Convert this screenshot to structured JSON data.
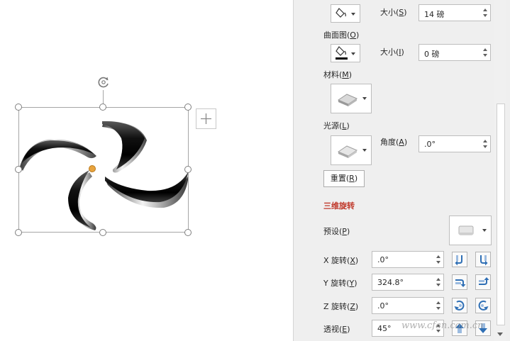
{
  "panel": {
    "size_top": {
      "label": "大小",
      "accel": "S",
      "value": "14 磅"
    },
    "contour": {
      "label": "曲面图",
      "accel": "O"
    },
    "size_contour": {
      "label": "大小",
      "accel": "I",
      "value": "0 磅"
    },
    "material": {
      "label": "材料",
      "accel": "M"
    },
    "lighting": {
      "label": "光源",
      "accel": "L"
    },
    "angle": {
      "label": "角度",
      "accel": "A",
      "value": ".0°"
    },
    "reset": {
      "label": "重置",
      "accel": "R"
    },
    "section_3d_rotation": "三维旋转",
    "preset": {
      "label": "预设",
      "accel": "P"
    },
    "x_rotation": {
      "label": "X 旋转",
      "accel": "X",
      "value": ".0°"
    },
    "y_rotation": {
      "label": "Y 旋转",
      "accel": "Y",
      "value": "324.8°"
    },
    "z_rotation": {
      "label": "Z 旋转",
      "accel": "Z",
      "value": ".0°"
    },
    "perspective": {
      "label": "透视",
      "accel": "E",
      "value": "45°"
    }
  },
  "watermark": "www.cfan.com.cn",
  "colors": {
    "panel_bg": "#efefef",
    "accent_red": "#c0392b",
    "icon_blue": "#2f6fb5",
    "adjust_handle": "#e8a33d"
  },
  "icons": [
    "rotate-handle-icon",
    "layout-options-icon",
    "paint-bucket-icon",
    "bevel-material-icon",
    "light-rig-icon",
    "preset-3d-icon",
    "rotate-left-icon",
    "rotate-right-icon",
    "rotate-up-icon",
    "rotate-down-icon",
    "rotate-ccw-icon",
    "rotate-cw-icon",
    "perspective-increase-icon",
    "perspective-decrease-icon"
  ]
}
